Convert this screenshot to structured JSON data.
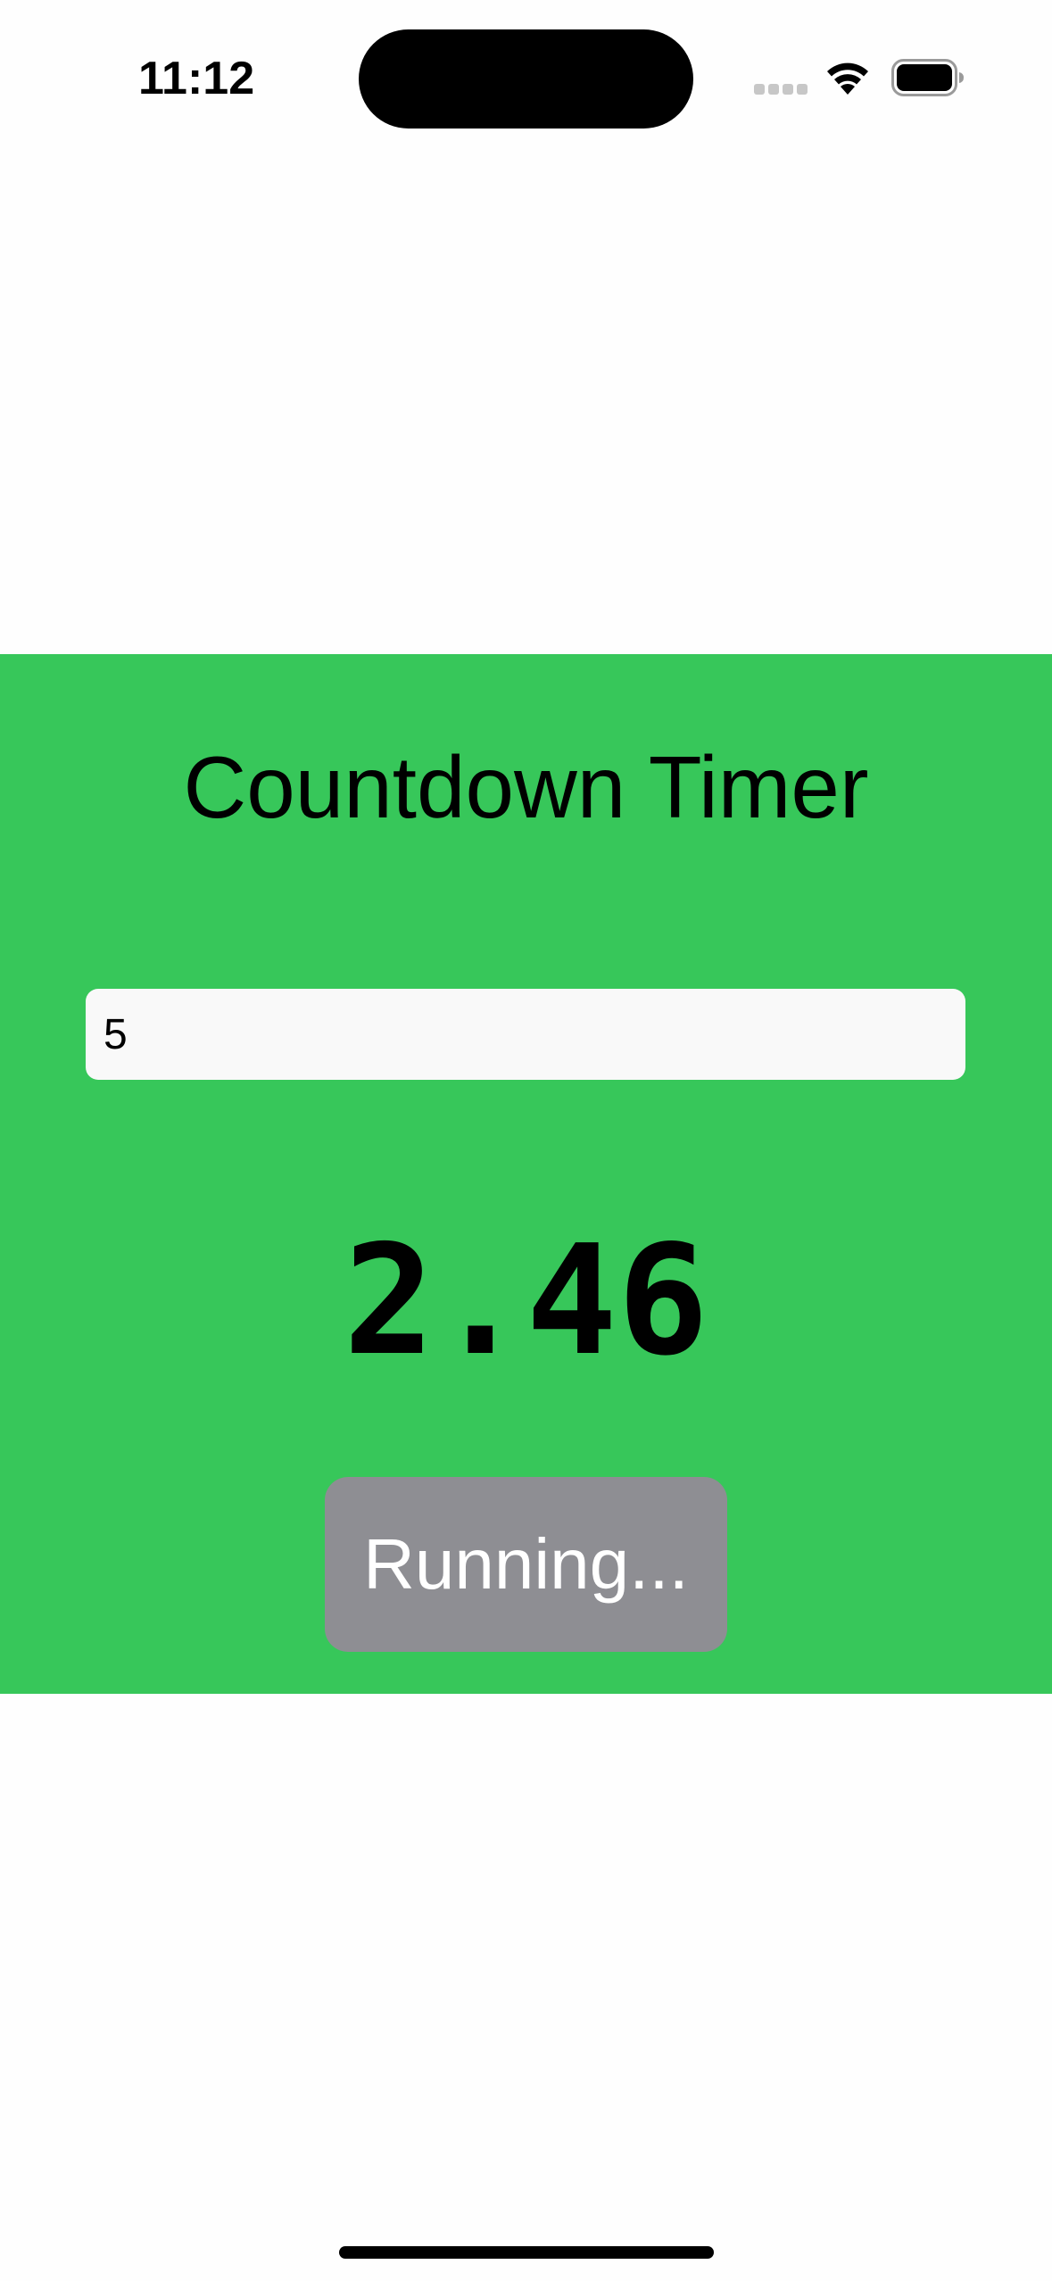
{
  "status_bar": {
    "time": "11:12",
    "icons": [
      "signal-dots-icon",
      "wifi-icon",
      "battery-icon"
    ]
  },
  "timer": {
    "title": "Countdown Timer",
    "input_value": "5",
    "remaining": "2.46",
    "button_label": "Running..."
  },
  "colors": {
    "panel_background": "#37c75a",
    "button_background": "#8e8e93",
    "input_background": "#f9f9f9"
  }
}
